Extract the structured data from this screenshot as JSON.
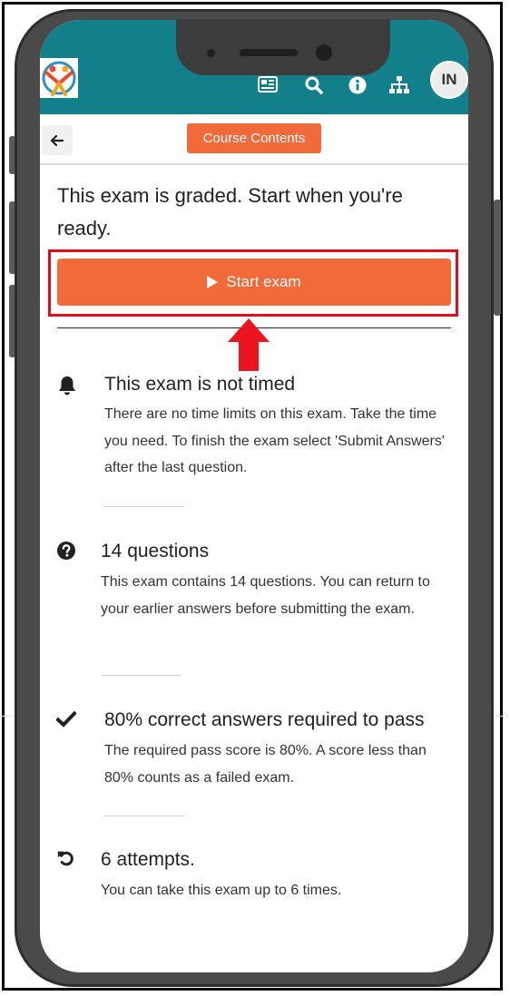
{
  "header": {
    "icons": [
      "newspaper-icon",
      "search-icon",
      "info-icon",
      "sitemap-icon"
    ],
    "avatar_initials": "IN",
    "colors": {
      "bar": "#12808a"
    }
  },
  "toolbar": {
    "back_icon": "arrow-left-icon",
    "course_contents_label": "Course Contents"
  },
  "exam": {
    "intro": "This exam is graded. Start when you're ready.",
    "start_label": "Start exam",
    "accent": "#f2693a",
    "highlight_color": "#e30c1a"
  },
  "info_items": [
    {
      "icon": "bell-icon",
      "title": "This exam is not timed",
      "text": "There are no time limits on this exam. Take the time you need.  To finish the exam select 'Submit Answers' after the last question."
    },
    {
      "icon": "question-circle-icon",
      "title": "14 questions",
      "text": "This exam contains 14 questions. You can return to your earlier answers before submitting the exam."
    },
    {
      "icon": "check-icon",
      "title": "80% correct answers required to pass",
      "text": "The required pass score is 80%. A score less than 80% counts as a failed exam."
    },
    {
      "icon": "undo-icon",
      "title": "6 attempts.",
      "text": "You can take this exam up to 6 times."
    }
  ]
}
